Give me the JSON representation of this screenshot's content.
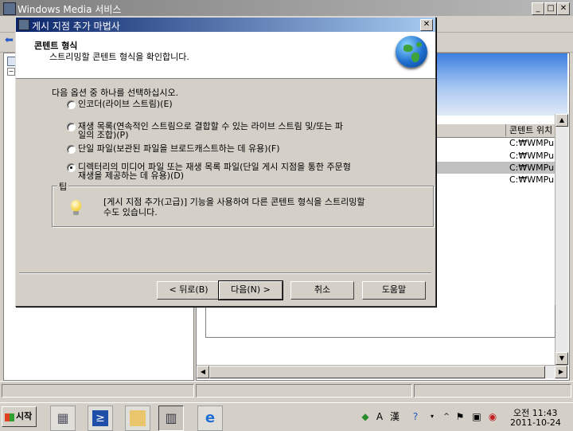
{
  "main_window": {
    "title": "Windows Media 서비스",
    "list": {
      "column_location": "콘텐트 위치",
      "rows": [
        "C:₩WMPub",
        "C:₩WMPub",
        "C:₩WMPub",
        "C:₩WMPub"
      ]
    }
  },
  "wizard": {
    "title": "게시 지점 추가 마법사",
    "header_title": "콘텐트 형식",
    "header_subtitle": "스트리밍할 콘텐트 형식을 확인합니다.",
    "instruction": "다음 옵션 중 하나를 선택하십시오.",
    "options": [
      {
        "label": "인코더(라이브 스트림)(E)",
        "selected": false
      },
      {
        "label_line1": "재생 목록(연속적인 스트림으로 결합할 수 있는 라이브 스트림 및/또는 파",
        "label_line2": "일의 조합)(P)",
        "selected": false
      },
      {
        "label": "단일 파일(보관된 파일을 브로드캐스트하는 데 유용)(F)",
        "selected": false
      },
      {
        "label_line1": "디렉터리의 미디어 파일 또는 재생 목록 파일(단일 게시 지점을 통한 주문형",
        "label_line2": "재생을 제공하는 데 유용)(D)",
        "selected": true
      }
    ],
    "tip_legend": "팁",
    "tip_line1": "[게시 지점 추가(고급)] 기능을 사용하여 다른 콘텐트 형식을 스트리밍할",
    "tip_line2": "수도 있습니다.",
    "buttons": {
      "back": "< 뒤로(B)",
      "next": "다음(N) >",
      "cancel": "취소",
      "help": "도움말"
    }
  },
  "taskbar": {
    "start_label": "시작",
    "clock_time": "오전 11:43",
    "clock_date": "2011-10-24",
    "ime_a": "A",
    "ime_han": "漢"
  }
}
